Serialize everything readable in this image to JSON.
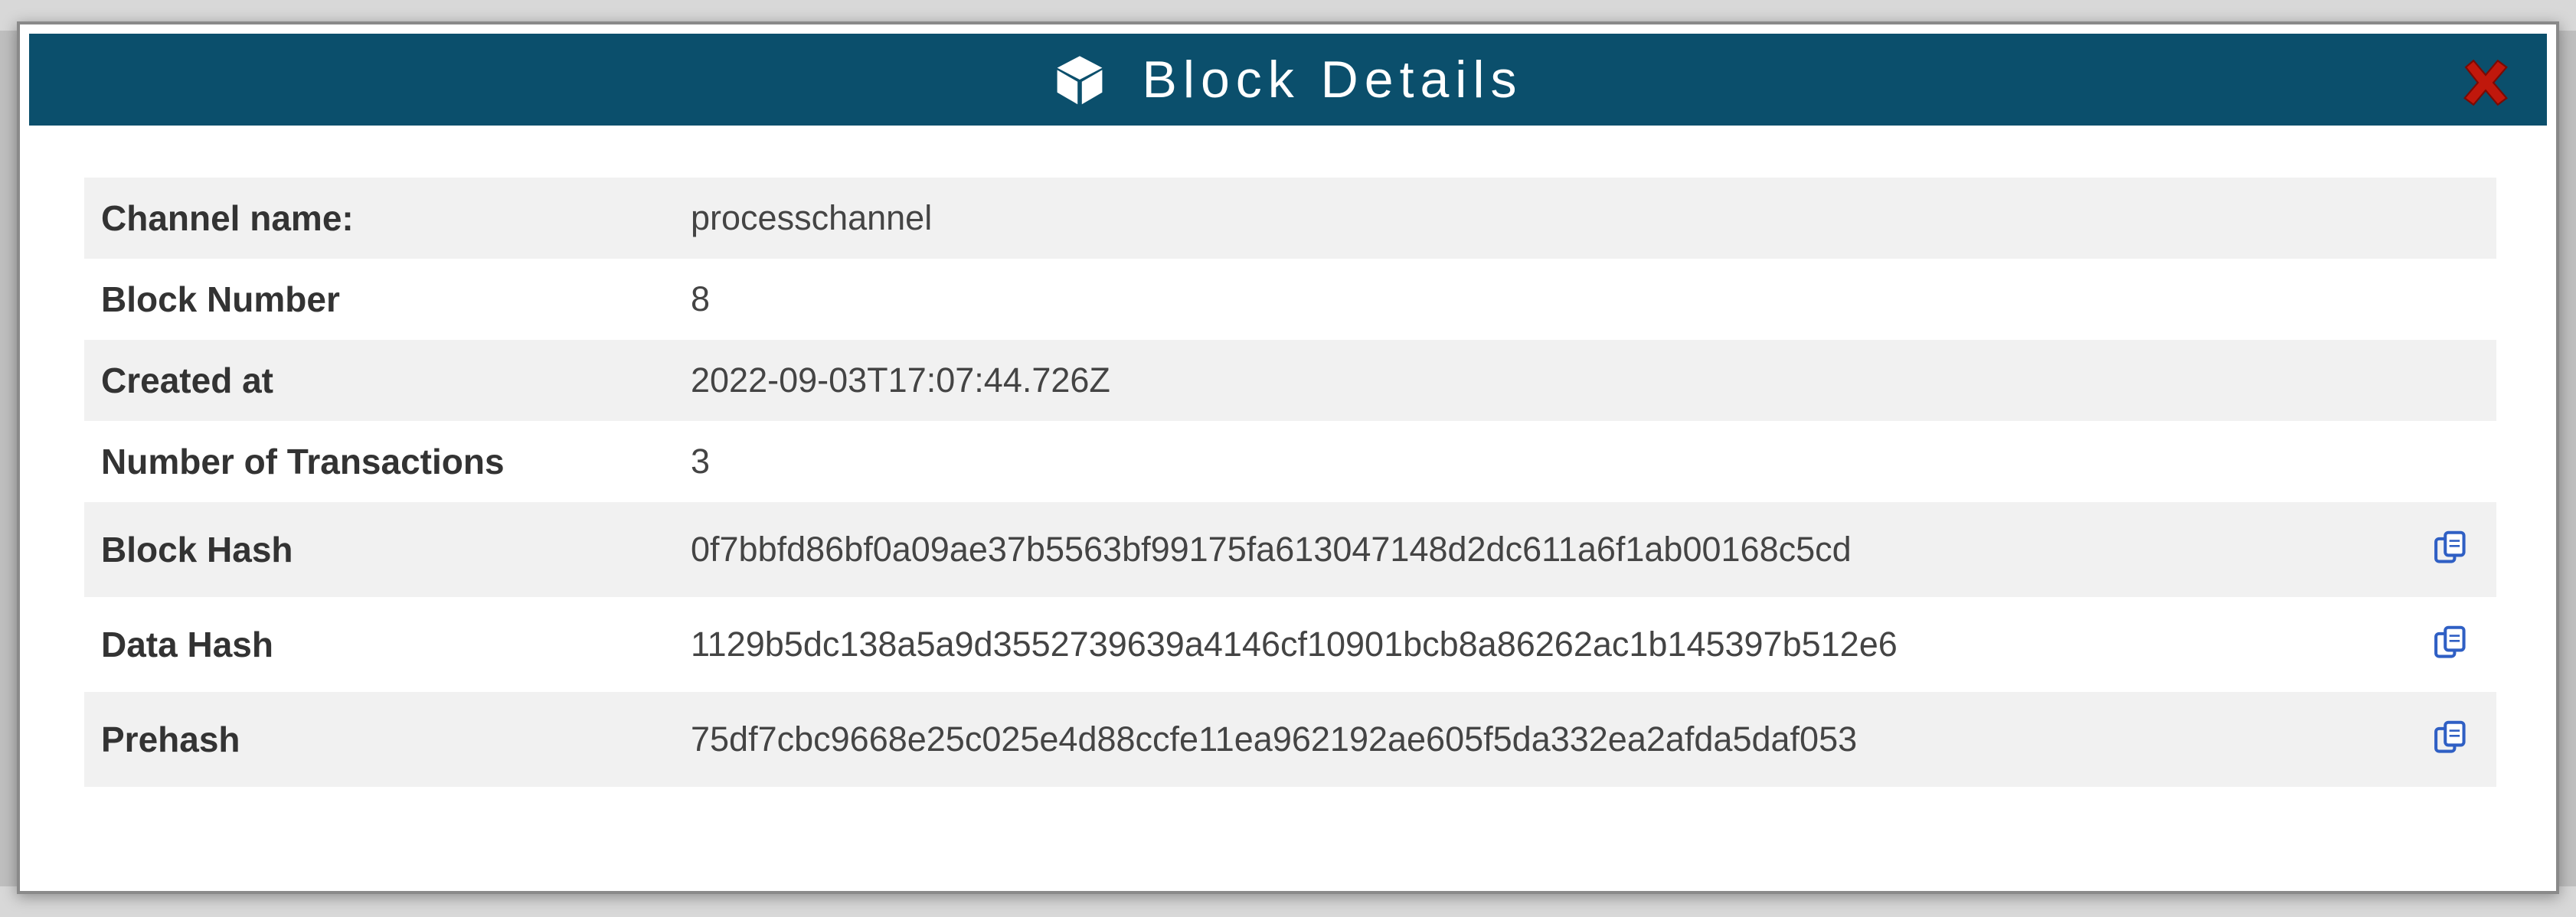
{
  "dialog": {
    "title": "Block Details",
    "header_color": "#0b4f6c",
    "header_icon": "cube-icon",
    "close_icon": "close-icon",
    "close_color": "#c0180c"
  },
  "details": {
    "channel": {
      "label": "Channel name:",
      "value": "processchannel"
    },
    "block_number": {
      "label": "Block Number",
      "value": "8"
    },
    "created_at": {
      "label": "Created at",
      "value": "2022-09-03T17:07:44.726Z"
    },
    "num_transactions": {
      "label": "Number of Transactions",
      "value": "3"
    },
    "block_hash": {
      "label": "Block Hash",
      "value": "0f7bbfd86bf0a09ae37b5563bf99175fa613047148d2dc611a6f1ab00168c5cd",
      "action_icon": "copy-icon"
    },
    "data_hash": {
      "label": "Data Hash",
      "value": "1129b5dc138a5a9d3552739639a4146cf10901bcb8a86262ac1b145397b512e6",
      "action_icon": "copy-icon"
    },
    "prehash": {
      "label": "Prehash",
      "value": "75df7cbc9668e25c025e4d88ccfe11ea962192ae605f5da332ea2afda5daf053",
      "action_icon": "copy-icon"
    }
  },
  "colors": {
    "row_shade": "#f1f1f1",
    "copy_icon": "#2f5fc4"
  }
}
